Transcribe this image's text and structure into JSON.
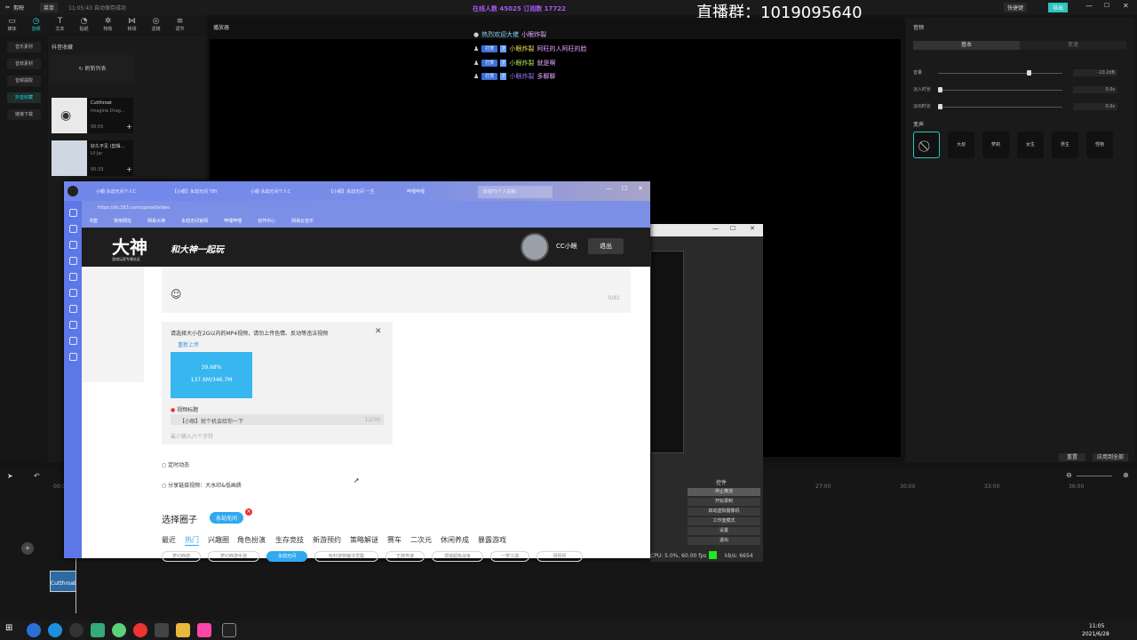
{
  "editor": {
    "app_name": "剪映",
    "menu": "菜单",
    "autosave": "11:05:43 自动保存成功",
    "share_btn": "快捷键",
    "export_btn": "导出",
    "tools": [
      {
        "icon": "media-icon",
        "label": "媒体"
      },
      {
        "icon": "audio-icon",
        "label": "音频"
      },
      {
        "icon": "text-icon",
        "label": "文本"
      },
      {
        "icon": "sticker-icon",
        "label": "贴纸"
      },
      {
        "icon": "effect-icon",
        "label": "特效"
      },
      {
        "icon": "transition-icon",
        "label": "转场"
      },
      {
        "icon": "filter-icon",
        "label": "滤镜"
      },
      {
        "icon": "adjust-icon",
        "label": "调节"
      }
    ],
    "nav": [
      "音乐素材",
      "音效素材",
      "音频提取",
      "抖音收藏",
      "链接下载"
    ],
    "media_header": "抖音收藏",
    "refresh": "刷新列表",
    "tracks": [
      {
        "title": "Cutthroat",
        "artist": "Imagine Drag...",
        "duration": "00:05"
      },
      {
        "title": "好久不见 (剪辑...",
        "artist": "UI Jar",
        "duration": "00:33"
      }
    ],
    "player_label": "播放器",
    "right": {
      "title": "音频",
      "tabs": [
        "基本",
        "变速"
      ],
      "volume_label": "音量",
      "volume_value": "-10.2dB",
      "fade_in_label": "淡入时长",
      "fade_in_value": "0.0s",
      "fade_out_label": "淡出时长",
      "fade_out_value": "0.0s",
      "voice_label": "变声",
      "voices": [
        "无",
        "大叔",
        "萝莉",
        "女生",
        "男生",
        "怪物"
      ],
      "reset_btn": "重置",
      "apply_all_btn": "应用到全部"
    },
    "timeline": {
      "ticks": [
        "00:00",
        "27:00",
        "30:00",
        "33:00",
        "36:00"
      ],
      "clip_label": "Cutthroat"
    }
  },
  "overlay": {
    "live_group": "直播群：1019095640",
    "online": "在线人数 45025 订阅数 17722"
  },
  "chat": [
    {
      "badge": "",
      "level": "",
      "user": "热烈欢迎大佬",
      "msg": "小眼炸裂"
    },
    {
      "badge": "打赏",
      "level": "7",
      "user": "小眼炸裂",
      "msg": "阿旺的人阿旺的脸"
    },
    {
      "badge": "打赏",
      "level": "7",
      "user": "小眼炸裂",
      "msg": "就是啊"
    },
    {
      "badge": "打赏",
      "level": "7",
      "user": "小眼炸裂",
      "msg": "多聊聊"
    }
  ],
  "browser": {
    "tabs": [
      "小眼·永劫无间个人C",
      "【小眼】永劫无间 TBY",
      "小眼·永劫无间个人C",
      "【小眼】永劫无间 一生",
      "哔哩哔哩",
      "影视TV个人投稿"
    ],
    "url": "https://ds.163.com/upload/video",
    "bookmarks": [
      "书签",
      "常用网址",
      "网易大神",
      "永劫无间官网",
      "哔哩哔哩",
      "创作中心",
      "网易云音乐"
    ],
    "site_logo": "大神",
    "site_logo_sub": "游戏玩家专属社区",
    "slogan": "和大神一起玩",
    "username": "CC小眼",
    "logout": "退出",
    "char_count": "0/81",
    "upload_hint": "请选择大小在2G以内的MP4视频，请勿上传色情、反动等违法视频",
    "reupload": "重新上传",
    "progress_percent": 39.68,
    "progress_text": "39.68%",
    "progress_size": "137.6M/346.7M",
    "video_title_label": "视频标题",
    "video_title_value": "【小眼】就个机会给你一下",
    "title_count": "12/30",
    "tag_hint": "最少输入六个字符",
    "option1": "定时动态",
    "option2": "分享链接视频：大水印&低画质",
    "choose_circle": "选择圈子",
    "selected_circle": "永劫无间",
    "categories": [
      "最近",
      "热门",
      "兴趣圈",
      "角色扮演",
      "生存竞技",
      "新游预约",
      "策略解谜",
      "赛车",
      "二次元",
      "休闲养成",
      "暴露游戏"
    ],
    "chips": [
      "梦幻西游",
      "梦幻西游手游",
      "永劫无间",
      "哈利波特魔法觉醒",
      "王牌竞速",
      "漫威超级战争",
      "一梦江湖",
      "阴阳师",
      "忘川风华录"
    ]
  },
  "obs": {
    "controls_header": "控件",
    "buttons": [
      "停止推流",
      "开始录制",
      "启动虚拟摄像机",
      "工作室模式",
      "设置",
      "退出"
    ],
    "status": "CPU: 5.0%, 60.00 fps",
    "bitrate": "kb/s: 6654"
  },
  "taskbar": {
    "time": "11:05",
    "date": "2021/6/28"
  }
}
